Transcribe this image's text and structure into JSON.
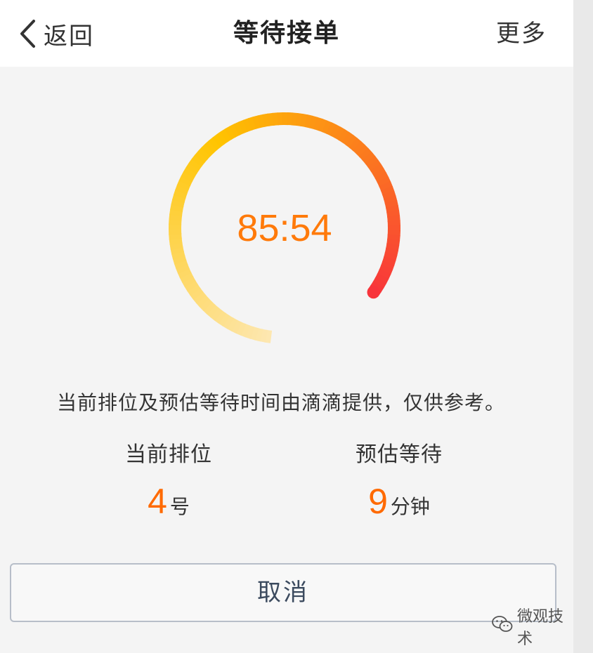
{
  "navbar": {
    "back_label": "返回",
    "title": "等待接单",
    "more_label": "更多",
    "back_icon": "chevron-left-icon"
  },
  "timer": {
    "display": "85:54",
    "progress_fraction": 0.83,
    "color_start": "#fde7b0",
    "color_mid": "#ffc400",
    "color_end": "#f8343b",
    "text_color": "#ff7a0a"
  },
  "notice": "当前排位及预估等待时间由滴滴提供，仅供参考。",
  "stats": {
    "queue": {
      "label": "当前排位",
      "value": "4",
      "unit": "号"
    },
    "wait": {
      "label": "预估等待",
      "value": "9",
      "unit": "分钟"
    }
  },
  "cancel_label": "取消",
  "watermark": {
    "text": "微观技术",
    "icon": "wechat-icon"
  },
  "colors": {
    "accent": "#ff6a00",
    "background": "#f4f4f4",
    "navbar_bg": "#ffffff",
    "button_text": "#3b4a5e"
  }
}
